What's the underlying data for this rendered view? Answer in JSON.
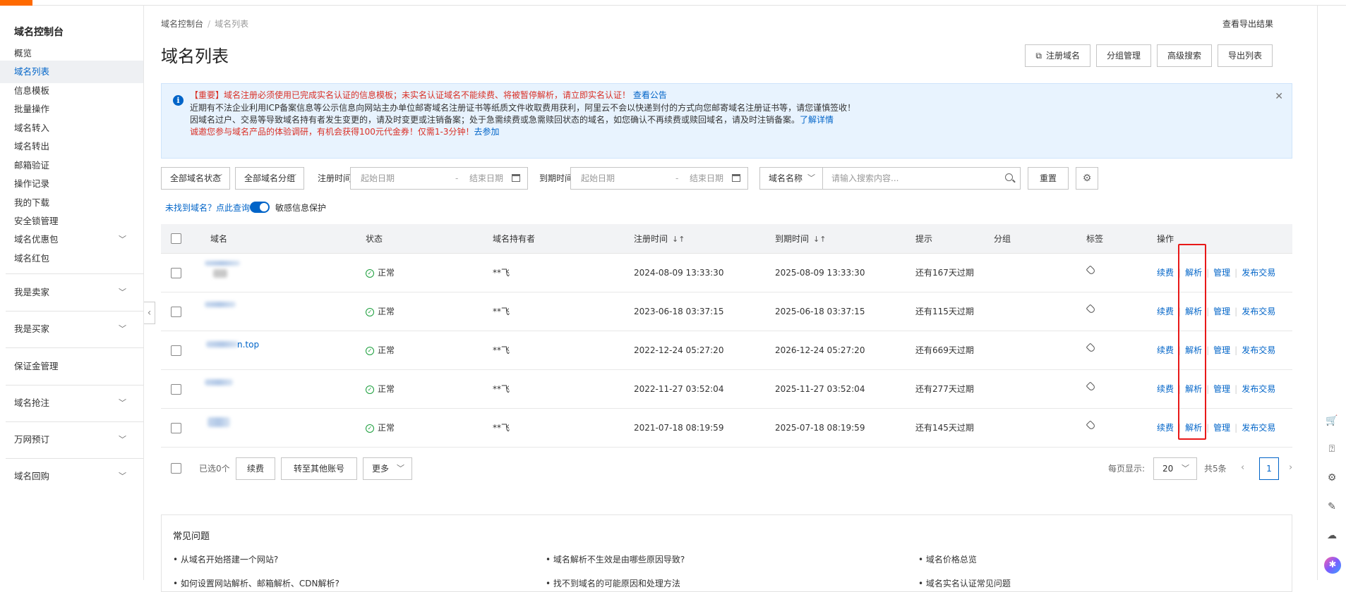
{
  "sidebar": {
    "title": "域名控制台",
    "items": [
      {
        "label": "概览"
      },
      {
        "label": "域名列表"
      },
      {
        "label": "信息模板"
      },
      {
        "label": "批量操作"
      },
      {
        "label": "域名转入"
      },
      {
        "label": "域名转出"
      },
      {
        "label": "邮箱验证"
      },
      {
        "label": "操作记录"
      },
      {
        "label": "我的下载"
      },
      {
        "label": "安全锁管理"
      },
      {
        "label": "域名优惠包"
      },
      {
        "label": "域名红包"
      }
    ],
    "groups": [
      {
        "label": "我是卖家"
      },
      {
        "label": "我是买家"
      },
      {
        "label": "保证金管理"
      },
      {
        "label": "域名抢注"
      },
      {
        "label": "万网预订"
      },
      {
        "label": "域名回购"
      }
    ]
  },
  "breadcrumb": {
    "root": "域名控制台",
    "current": "域名列表"
  },
  "header": {
    "export_result": "查看导出结果",
    "title": "域名列表",
    "buttons": {
      "register": "注册域名",
      "group": "分组管理",
      "advanced": "高级搜索",
      "export": "导出列表"
    }
  },
  "notice": {
    "line1_red": "【重要】域名注册必须使用已完成实名认证的信息模板；未实名认证域名不能续费、将被暂停解析，请立即实名认证！",
    "line1_link": "查看公告",
    "line2": "近期有不法企业利用ICP备案信息等公示信息向网站主办单位邮寄域名注册证书等纸质文件收取费用获利，阿里云不会以快递到付的方式向您邮寄域名注册证书等，请您谨慎签收！",
    "line3": "因域名过户、交易等导致域名持有者发生变更的，请及时变更或注销备案；处于急需续费或急需赎回状态的域名，如您确认不再续费或赎回域名，请及时注销备案。",
    "line3_link": "了解详情",
    "line4_red": "诚邀您参与域名产品的体验调研，有机会获得100元代金券！仅需1-3分钟！",
    "line4_link": "去参加"
  },
  "filters": {
    "status": "全部域名状态",
    "group": "全部域名分组",
    "reg_label": "注册时间",
    "exp_label": "到期时间",
    "start_placeholder": "起始日期",
    "end_placeholder": "结束日期",
    "search_field": "域名名称",
    "search_placeholder": "请输入搜索内容...",
    "reset": "重置"
  },
  "options": {
    "not_found_link": "未找到域名？点此查询",
    "sensitive_label": "敏感信息保护"
  },
  "table": {
    "headers": {
      "domain": "域名",
      "status": "状态",
      "holder": "域名持有者",
      "reg_time": "注册时间",
      "exp_time": "到期时间",
      "tip": "提示",
      "group": "分组",
      "tag": "标签",
      "ops": "操作"
    },
    "rows": [
      {
        "domain": "",
        "status": "正常",
        "holder": "**飞",
        "reg": "2024-08-09 13:33:30",
        "exp": "2025-08-09 13:33:30",
        "tip": "还有167天过期"
      },
      {
        "domain": "",
        "status": "正常",
        "holder": "**飞",
        "reg": "2023-06-18 03:37:15",
        "exp": "2025-06-18 03:37:15",
        "tip": "还有115天过期"
      },
      {
        "domain": "n.top",
        "status": "正常",
        "holder": "**飞",
        "reg": "2022-12-24 05:27:20",
        "exp": "2026-12-24 05:27:20",
        "tip": "还有669天过期"
      },
      {
        "domain": "",
        "status": "正常",
        "holder": "**飞",
        "reg": "2022-11-27 03:52:04",
        "exp": "2025-11-27 03:52:04",
        "tip": "还有277天过期"
      },
      {
        "domain": "",
        "status": "正常",
        "holder": "**飞",
        "reg": "2021-07-18 08:19:59",
        "exp": "2025-07-18 08:19:59",
        "tip": "还有145天过期"
      }
    ],
    "ops": {
      "renew": "续费",
      "resolve": "解析",
      "manage": "管理",
      "trade": "发布交易"
    }
  },
  "footer": {
    "selected": "已选0个",
    "renew": "续费",
    "transfer": "转至其他账号",
    "more": "更多",
    "per_page_label": "每页显示:",
    "per_page": "20",
    "total": "共5条",
    "page": "1"
  },
  "faq": {
    "title": "常见问题",
    "items": [
      "• 从域名开始搭建一个网站?",
      "• 域名解析不生效是由哪些原因导致?",
      "• 域名价格总览",
      "• 如何设置网站解析、邮箱解析、CDN解析?",
      "• 找不到域名的可能原因和处理方法",
      "• 域名实名认证常见问题"
    ]
  },
  "icons": [
    "info-icon",
    "close-icon",
    "calendar-icon",
    "search-icon",
    "gear-icon",
    "check-circle-icon",
    "tag-icon",
    "cart-icon",
    "help-icon",
    "settings-icon",
    "edit-icon",
    "cloud-icon",
    "assistant-icon"
  ],
  "colors": {
    "accent": "#0064c8",
    "brand": "#ff6a00",
    "warning": "#d93026",
    "ok": "#1a9e3b",
    "highlight_box": "#e81818"
  }
}
